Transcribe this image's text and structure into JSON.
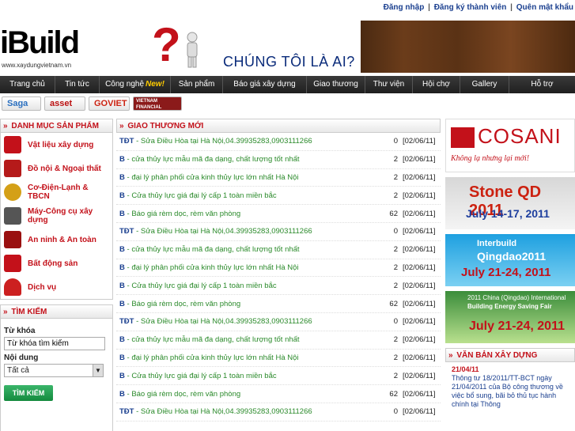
{
  "toplinks": {
    "login": "Đăng nhập",
    "register": "Đăng ký thành viên",
    "forgot": "Quên mật khẩu",
    "sep": "|"
  },
  "logo": {
    "word": "iBuild",
    "url": "www.xaydungvietnam.vn"
  },
  "banner": {
    "qmark": "?",
    "slogan": "CHÚNG TÔI LÀ AI?"
  },
  "nav": [
    {
      "label": "Trang chủ"
    },
    {
      "label": "Tin tức"
    },
    {
      "label": "Công nghệ",
      "badge": "New!"
    },
    {
      "label": "Sản phẩm"
    },
    {
      "label": "Báo giá xây dựng"
    },
    {
      "label": "Giao thương"
    },
    {
      "label": "Thư viện"
    },
    {
      "label": "Hội chợ"
    },
    {
      "label": "Gallery"
    },
    {
      "label": "Hỗ trợ"
    }
  ],
  "partners": [
    "Saga",
    "asset",
    "GOVIET",
    "VIETNAM FINANCIAL REVIEW"
  ],
  "left": {
    "catalog_title": "DANH MỤC SẢN PHẨM",
    "arrows": "»",
    "categories": [
      {
        "label": "Vật liệu xây dựng",
        "color": "#c3111a"
      },
      {
        "label": "Đồ nội & Ngoại thất",
        "color": "#b51a1a"
      },
      {
        "label": "Cơ-Điện-Lạnh & TBCN",
        "color": "#d4a017"
      },
      {
        "label": "Máy-Công cụ xây dựng",
        "color": "#555555"
      },
      {
        "label": "An ninh & An toàn",
        "color": "#9a1010"
      },
      {
        "label": "Bất động sản",
        "color": "#c3111a"
      },
      {
        "label": "Dịch vụ",
        "color": "#cc2020"
      }
    ],
    "search_title": "TÌM KIẾM",
    "keyword_label": "Từ khóa",
    "keyword_value": "Từ khóa tìm kiếm",
    "content_label": "Nội dung",
    "content_value": "Tất cả",
    "search_button": "TÌM KIẾM"
  },
  "center": {
    "title": "GIAO THƯƠNG MỚI",
    "rows": [
      {
        "code": "TĐT",
        "text": " - Sửa Điều Hòa tại Hà Nội,04.39935283,0903111266",
        "count": "0",
        "date": "[02/06/11]"
      },
      {
        "code": "B",
        "text": " - cửa thủy lực mẫu mã đa dạng, chất lượng tốt nhất",
        "count": "2",
        "date": "[02/06/11]"
      },
      {
        "code": "B",
        "text": " - đại lý phân phối cửa kinh thủy lực lớn nhất Hà Nội",
        "count": "2",
        "date": "[02/06/11]"
      },
      {
        "code": "B",
        "text": " - Cửa thủy lực giá đại lý cấp 1 toàn miền bắc",
        "count": "2",
        "date": "[02/06/11]"
      },
      {
        "code": "B",
        "text": " - Báo giá rèm dọc, rèm văn phòng",
        "count": "62",
        "date": "[02/06/11]"
      },
      {
        "code": "TĐT",
        "text": " - Sửa Điều Hòa tại Hà Nội,04.39935283,0903111266",
        "count": "0",
        "date": "[02/06/11]"
      },
      {
        "code": "B",
        "text": " - cửa thủy lực mẫu mã đa dạng, chất lượng tốt nhất",
        "count": "2",
        "date": "[02/06/11]"
      },
      {
        "code": "B",
        "text": " - đại lý phân phối cửa kinh thủy lực lớn nhất Hà Nội",
        "count": "2",
        "date": "[02/06/11]"
      },
      {
        "code": "B",
        "text": " - Cửa thủy lực giá đại lý cấp 1 toàn miền bắc",
        "count": "2",
        "date": "[02/06/11]"
      },
      {
        "code": "B",
        "text": " - Báo giá rèm dọc, rèm văn phòng",
        "count": "62",
        "date": "[02/06/11]"
      },
      {
        "code": "TĐT",
        "text": " - Sửa Điều Hòa tại Hà Nội,04.39935283,0903111266",
        "count": "0",
        "date": "[02/06/11]"
      },
      {
        "code": "B",
        "text": " - cửa thủy lực mẫu mã đa dạng, chất lượng tốt nhất",
        "count": "2",
        "date": "[02/06/11]"
      },
      {
        "code": "B",
        "text": " - đại lý phân phối cửa kinh thủy lực lớn nhất Hà Nội",
        "count": "2",
        "date": "[02/06/11]"
      },
      {
        "code": "B",
        "text": " - Cửa thủy lực giá đại lý cấp 1 toàn miền bắc",
        "count": "2",
        "date": "[02/06/11]"
      },
      {
        "code": "B",
        "text": " - Báo giá rèm dọc, rèm văn phòng",
        "count": "62",
        "date": "[02/06/11]"
      },
      {
        "code": "TĐT",
        "text": " - Sửa Điều Hòa tại Hà Nội,04.39935283,0903111266",
        "count": "0",
        "date": "[02/06/11]"
      }
    ]
  },
  "right": {
    "ad1": {
      "brand": "COSANI",
      "tag": "Không lạ nhưng lại mới!"
    },
    "ad2": {
      "t1": "Stone QD 2011",
      "t2": "July 14-17, 2011"
    },
    "ad3": {
      "t1": "Interbuild",
      "t2": "Qingdao2011",
      "t3": "July 21-24, 2011"
    },
    "ad4": {
      "t1": "2011 China (Qingdao) International",
      "t2": "Building Energy Saving Fair",
      "t3": "July 21-24, 2011"
    },
    "docs_title": "VĂN BẢN XÂY DỰNG",
    "doc": {
      "date": "21/04/11",
      "text": "Thông tư 18/2011/TT-BCT ngày 21/04/2011 của Bộ công thương về việc bổ sung, bãi bỏ thủ tục hành chính tại Thông"
    }
  }
}
